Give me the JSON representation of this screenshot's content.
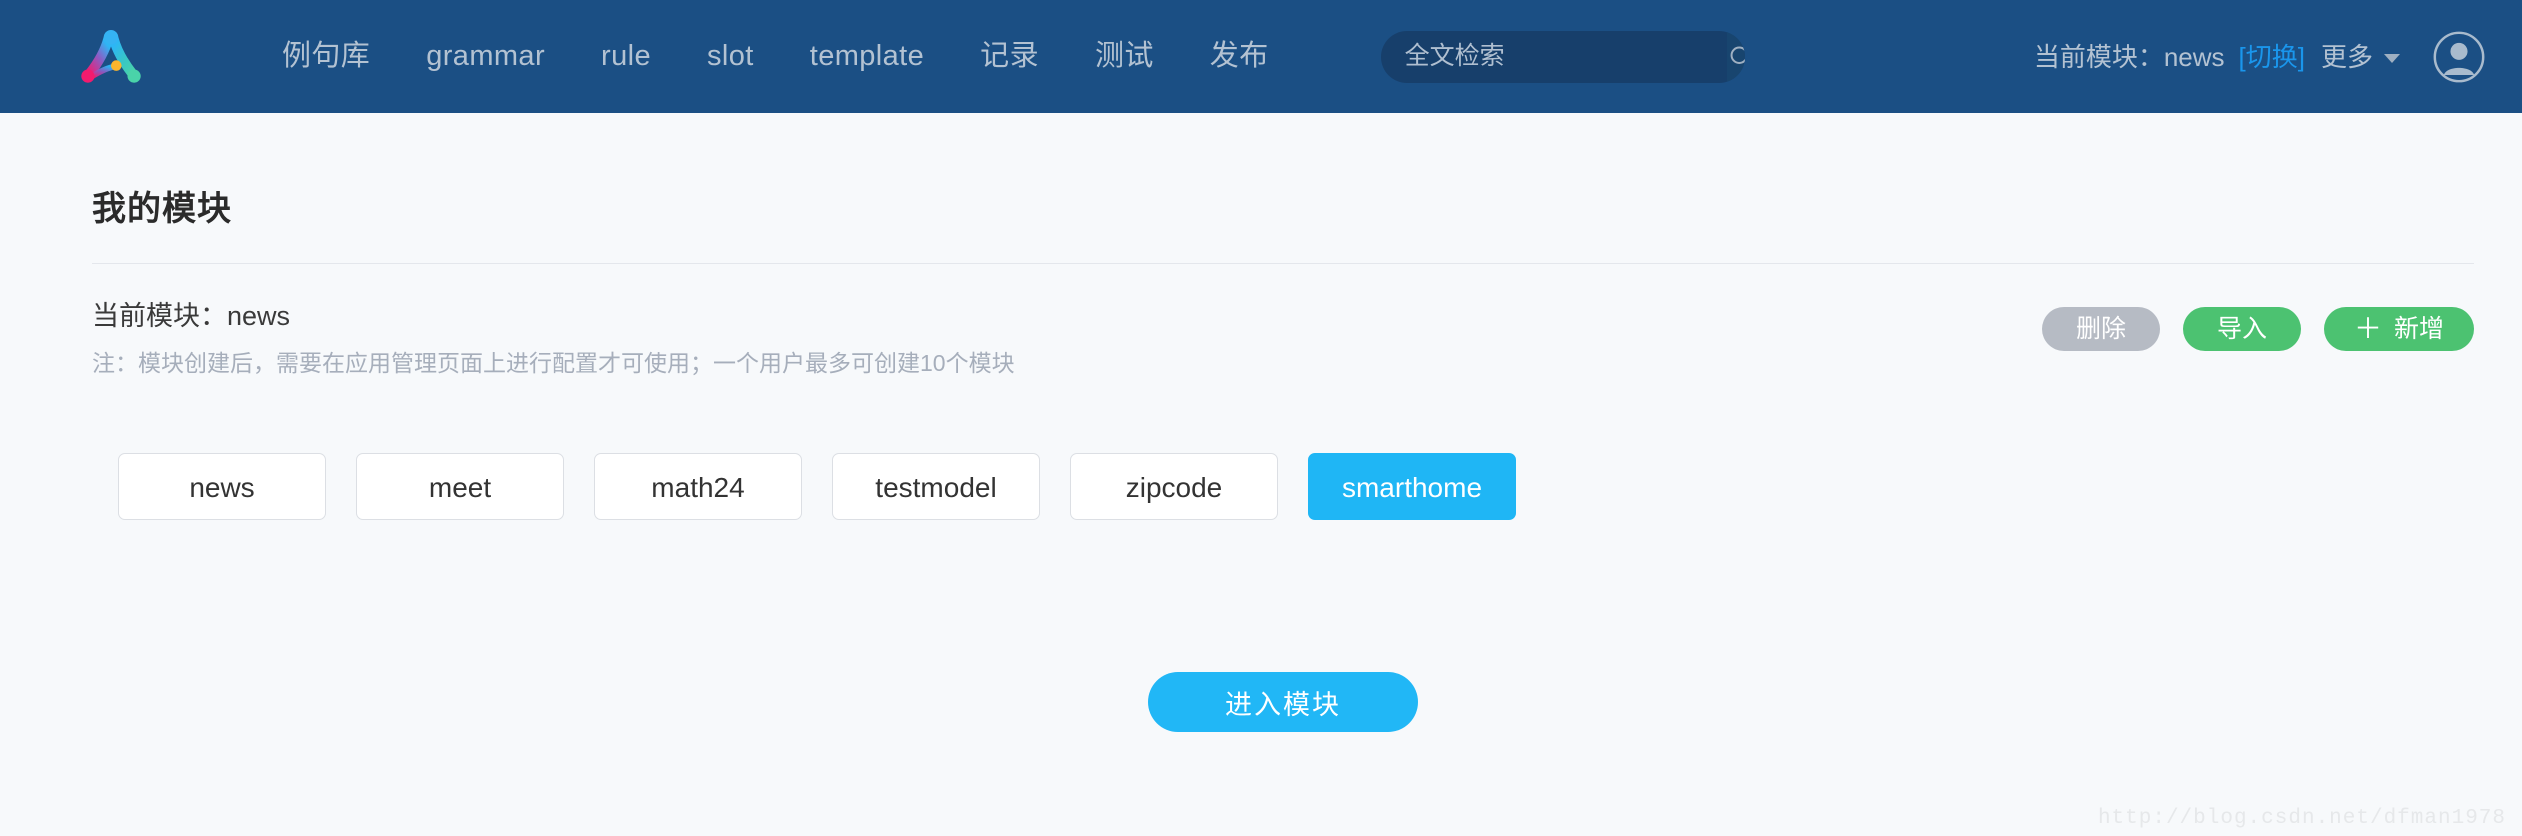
{
  "header": {
    "logo_icon": "abc-logo-icon",
    "nav_items": [
      {
        "label": "例句库"
      },
      {
        "label": "grammar"
      },
      {
        "label": "rule"
      },
      {
        "label": "slot"
      },
      {
        "label": "template"
      },
      {
        "label": "记录"
      },
      {
        "label": "测试"
      },
      {
        "label": "发布"
      }
    ],
    "search": {
      "value": "",
      "placeholder": "全文检索",
      "icon": "search-icon"
    },
    "current_module_label": "当前模块：news",
    "switch_link": "[切换]",
    "more_link": "更多",
    "more_caret_icon": "chevron-down-icon",
    "avatar_icon": "user-avatar-icon"
  },
  "main": {
    "page_title": "我的模块",
    "current_module": "当前模块：news",
    "note": "注：模块创建后，需要在应用管理页面上进行配置才可使用；一个用户最多可创建10个模块",
    "actions": {
      "delete_label": "删除",
      "import_label": "导入",
      "add_label": "新增",
      "add_plus_icon": "plus-icon"
    },
    "modules": [
      {
        "name": "news",
        "selected": false
      },
      {
        "name": "meet",
        "selected": false
      },
      {
        "name": "math24",
        "selected": false
      },
      {
        "name": "testmodel",
        "selected": false
      },
      {
        "name": "zipcode",
        "selected": false
      },
      {
        "name": "smarthome",
        "selected": true
      }
    ],
    "enter_button_label": "进入模块"
  },
  "watermark": "http://blog.csdn.net/dfman1978",
  "colors": {
    "header_bg": "#1b4f84",
    "page_bg": "#f7f9fb",
    "accent_blue": "#1fb6f5",
    "link_blue": "#1a96ec",
    "green": "#4cc271",
    "gray_disabled": "#b6bbc4",
    "nav_text": "#b3c2d2"
  }
}
